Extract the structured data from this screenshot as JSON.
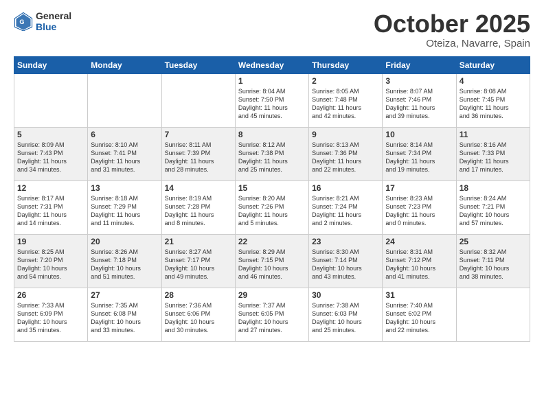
{
  "header": {
    "logo_general": "General",
    "logo_blue": "Blue",
    "month": "October 2025",
    "location": "Oteiza, Navarre, Spain"
  },
  "weekdays": [
    "Sunday",
    "Monday",
    "Tuesday",
    "Wednesday",
    "Thursday",
    "Friday",
    "Saturday"
  ],
  "weeks": [
    [
      {
        "day": "",
        "info": ""
      },
      {
        "day": "",
        "info": ""
      },
      {
        "day": "",
        "info": ""
      },
      {
        "day": "1",
        "info": "Sunrise: 8:04 AM\nSunset: 7:50 PM\nDaylight: 11 hours\nand 45 minutes."
      },
      {
        "day": "2",
        "info": "Sunrise: 8:05 AM\nSunset: 7:48 PM\nDaylight: 11 hours\nand 42 minutes."
      },
      {
        "day": "3",
        "info": "Sunrise: 8:07 AM\nSunset: 7:46 PM\nDaylight: 11 hours\nand 39 minutes."
      },
      {
        "day": "4",
        "info": "Sunrise: 8:08 AM\nSunset: 7:45 PM\nDaylight: 11 hours\nand 36 minutes."
      }
    ],
    [
      {
        "day": "5",
        "info": "Sunrise: 8:09 AM\nSunset: 7:43 PM\nDaylight: 11 hours\nand 34 minutes."
      },
      {
        "day": "6",
        "info": "Sunrise: 8:10 AM\nSunset: 7:41 PM\nDaylight: 11 hours\nand 31 minutes."
      },
      {
        "day": "7",
        "info": "Sunrise: 8:11 AM\nSunset: 7:39 PM\nDaylight: 11 hours\nand 28 minutes."
      },
      {
        "day": "8",
        "info": "Sunrise: 8:12 AM\nSunset: 7:38 PM\nDaylight: 11 hours\nand 25 minutes."
      },
      {
        "day": "9",
        "info": "Sunrise: 8:13 AM\nSunset: 7:36 PM\nDaylight: 11 hours\nand 22 minutes."
      },
      {
        "day": "10",
        "info": "Sunrise: 8:14 AM\nSunset: 7:34 PM\nDaylight: 11 hours\nand 19 minutes."
      },
      {
        "day": "11",
        "info": "Sunrise: 8:16 AM\nSunset: 7:33 PM\nDaylight: 11 hours\nand 17 minutes."
      }
    ],
    [
      {
        "day": "12",
        "info": "Sunrise: 8:17 AM\nSunset: 7:31 PM\nDaylight: 11 hours\nand 14 minutes."
      },
      {
        "day": "13",
        "info": "Sunrise: 8:18 AM\nSunset: 7:29 PM\nDaylight: 11 hours\nand 11 minutes."
      },
      {
        "day": "14",
        "info": "Sunrise: 8:19 AM\nSunset: 7:28 PM\nDaylight: 11 hours\nand 8 minutes."
      },
      {
        "day": "15",
        "info": "Sunrise: 8:20 AM\nSunset: 7:26 PM\nDaylight: 11 hours\nand 5 minutes."
      },
      {
        "day": "16",
        "info": "Sunrise: 8:21 AM\nSunset: 7:24 PM\nDaylight: 11 hours\nand 2 minutes."
      },
      {
        "day": "17",
        "info": "Sunrise: 8:23 AM\nSunset: 7:23 PM\nDaylight: 11 hours\nand 0 minutes."
      },
      {
        "day": "18",
        "info": "Sunrise: 8:24 AM\nSunset: 7:21 PM\nDaylight: 10 hours\nand 57 minutes."
      }
    ],
    [
      {
        "day": "19",
        "info": "Sunrise: 8:25 AM\nSunset: 7:20 PM\nDaylight: 10 hours\nand 54 minutes."
      },
      {
        "day": "20",
        "info": "Sunrise: 8:26 AM\nSunset: 7:18 PM\nDaylight: 10 hours\nand 51 minutes."
      },
      {
        "day": "21",
        "info": "Sunrise: 8:27 AM\nSunset: 7:17 PM\nDaylight: 10 hours\nand 49 minutes."
      },
      {
        "day": "22",
        "info": "Sunrise: 8:29 AM\nSunset: 7:15 PM\nDaylight: 10 hours\nand 46 minutes."
      },
      {
        "day": "23",
        "info": "Sunrise: 8:30 AM\nSunset: 7:14 PM\nDaylight: 10 hours\nand 43 minutes."
      },
      {
        "day": "24",
        "info": "Sunrise: 8:31 AM\nSunset: 7:12 PM\nDaylight: 10 hours\nand 41 minutes."
      },
      {
        "day": "25",
        "info": "Sunrise: 8:32 AM\nSunset: 7:11 PM\nDaylight: 10 hours\nand 38 minutes."
      }
    ],
    [
      {
        "day": "26",
        "info": "Sunrise: 7:33 AM\nSunset: 6:09 PM\nDaylight: 10 hours\nand 35 minutes."
      },
      {
        "day": "27",
        "info": "Sunrise: 7:35 AM\nSunset: 6:08 PM\nDaylight: 10 hours\nand 33 minutes."
      },
      {
        "day": "28",
        "info": "Sunrise: 7:36 AM\nSunset: 6:06 PM\nDaylight: 10 hours\nand 30 minutes."
      },
      {
        "day": "29",
        "info": "Sunrise: 7:37 AM\nSunset: 6:05 PM\nDaylight: 10 hours\nand 27 minutes."
      },
      {
        "day": "30",
        "info": "Sunrise: 7:38 AM\nSunset: 6:03 PM\nDaylight: 10 hours\nand 25 minutes."
      },
      {
        "day": "31",
        "info": "Sunrise: 7:40 AM\nSunset: 6:02 PM\nDaylight: 10 hours\nand 22 minutes."
      },
      {
        "day": "",
        "info": ""
      }
    ]
  ]
}
